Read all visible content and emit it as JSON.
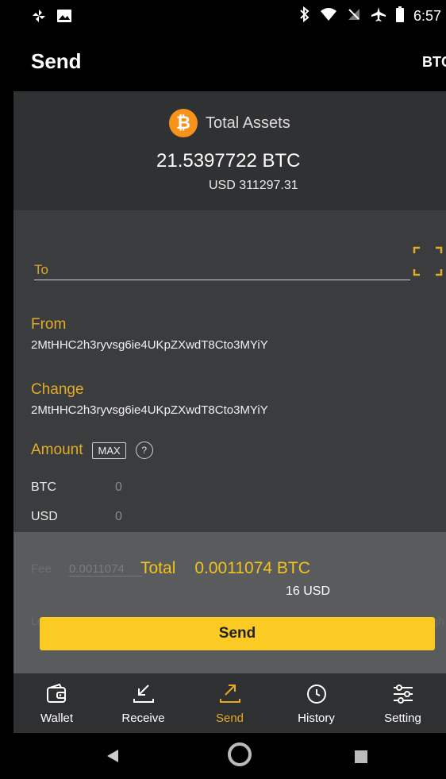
{
  "status_bar": {
    "time": "6:57"
  },
  "app_bar": {
    "title": "Send",
    "currency": "BTC"
  },
  "assets": {
    "label": "Total Assets",
    "btc_value": "21.5397722 BTC",
    "usd_value": "USD 311297.31"
  },
  "form": {
    "to_placeholder": "To",
    "from_label": "From",
    "from_address": "2MtHHC2h3ryvsg6ie4UKpZXwdT8Cto3MYiY",
    "change_label": "Change",
    "change_address": "2MtHHC2h3ryvsg6ie4UKpZXwdT8Cto3MYiY",
    "amount_label": "Amount",
    "max_label": "MAX",
    "help_label": "?",
    "btc_label": "BTC",
    "btc_value": "0",
    "usd_label": "USD",
    "usd_value": "0"
  },
  "fee": {
    "label": "Fee",
    "value": "0.0011074",
    "low_label": "Low",
    "high_label": "High"
  },
  "total": {
    "label": "Total",
    "btc": "0.0011074 BTC",
    "usd": "16 USD"
  },
  "send_button": "Send",
  "nav": {
    "items": [
      {
        "label": "Wallet",
        "icon": "wallet-icon"
      },
      {
        "label": "Receive",
        "icon": "receive-arrow-icon"
      },
      {
        "label": "Send",
        "icon": "send-arrow-icon",
        "active": true
      },
      {
        "label": "History",
        "icon": "clock-icon"
      },
      {
        "label": "Setting",
        "icon": "sliders-icon"
      }
    ]
  },
  "colors": {
    "accent": "#f3c21b",
    "active_nav": "#e9a91f",
    "label_gold": "#e0ac2a",
    "btc_orange": "#f7931a"
  }
}
